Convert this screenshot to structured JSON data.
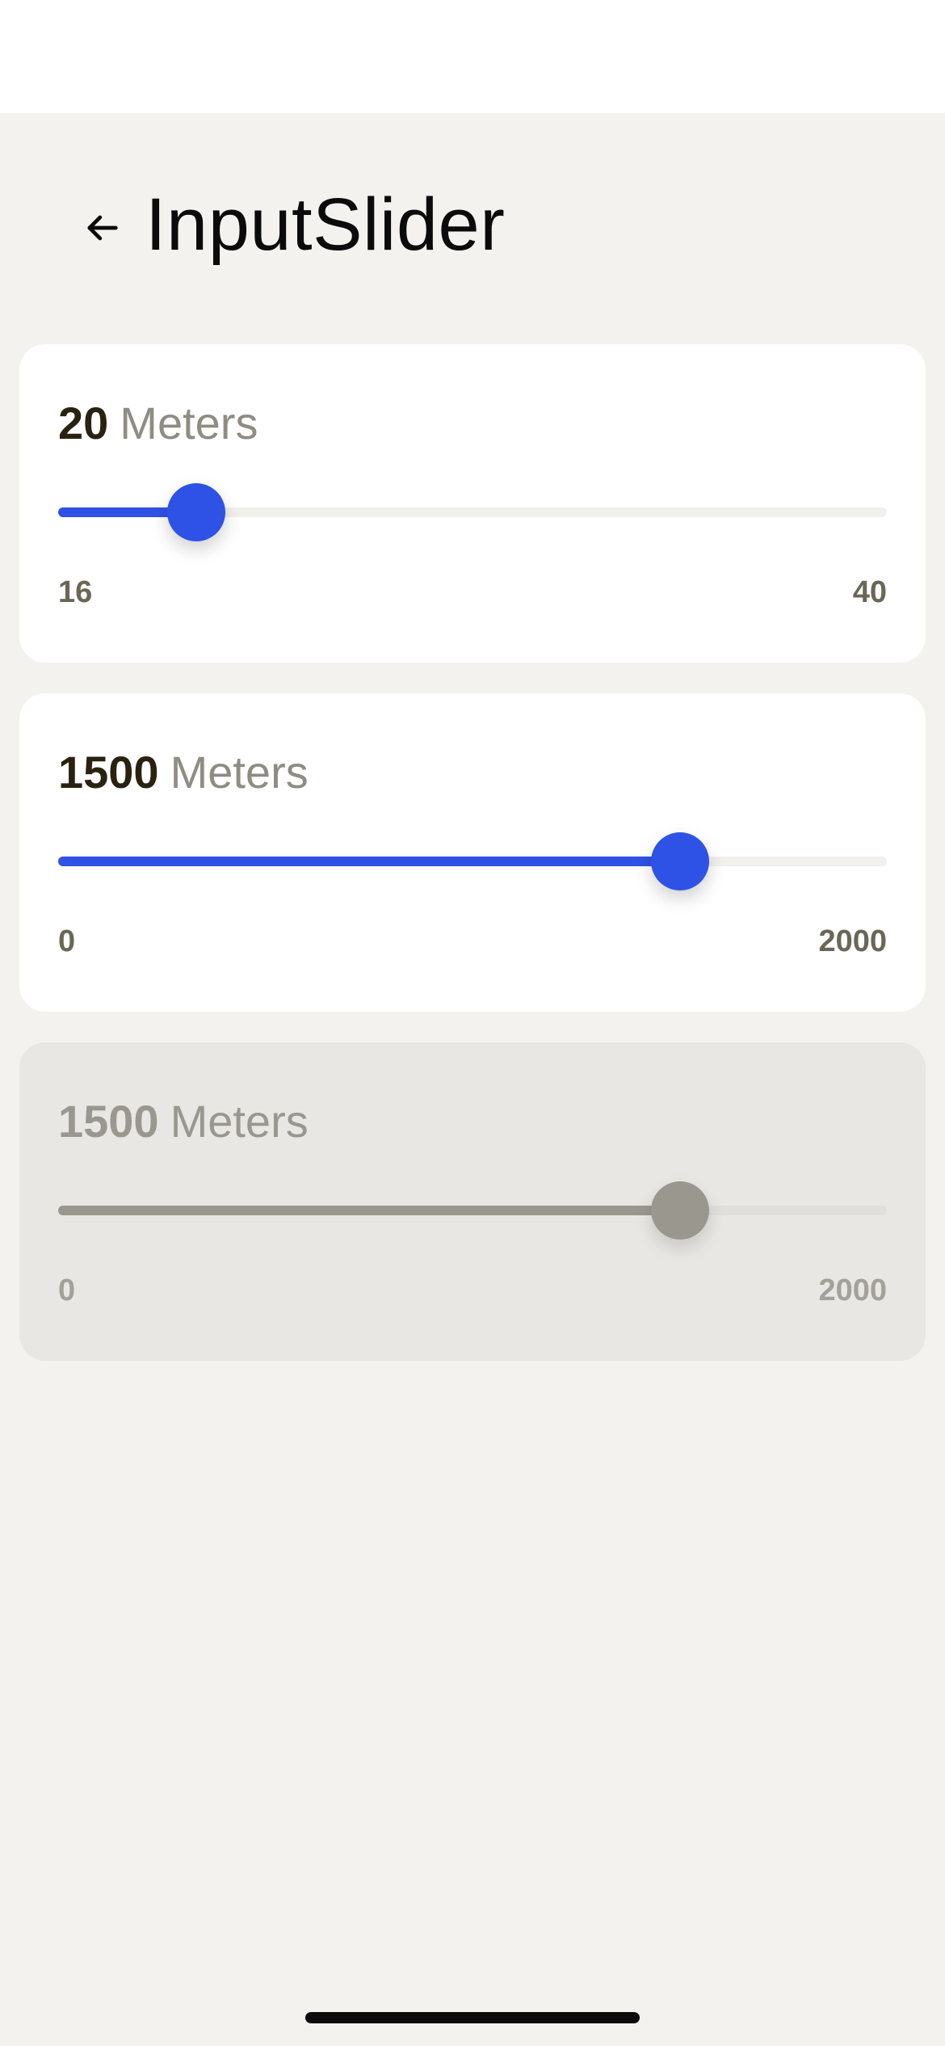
{
  "header": {
    "back_icon": "arrow-left-icon",
    "title": "InputSlider"
  },
  "sliders": [
    {
      "value": "20",
      "unit": "Meters",
      "min": "16",
      "max": "40",
      "position": 0.167,
      "disabled": false
    },
    {
      "value": "1500",
      "unit": "Meters",
      "min": "0",
      "max": "2000",
      "position": 0.75,
      "disabled": false
    },
    {
      "value": "1500",
      "unit": "Meters",
      "min": "0",
      "max": "2000",
      "position": 0.75,
      "disabled": true
    }
  ],
  "colors": {
    "accent": "#2f52e6",
    "disabled": "#9a978f",
    "background": "#f3f2ef"
  }
}
